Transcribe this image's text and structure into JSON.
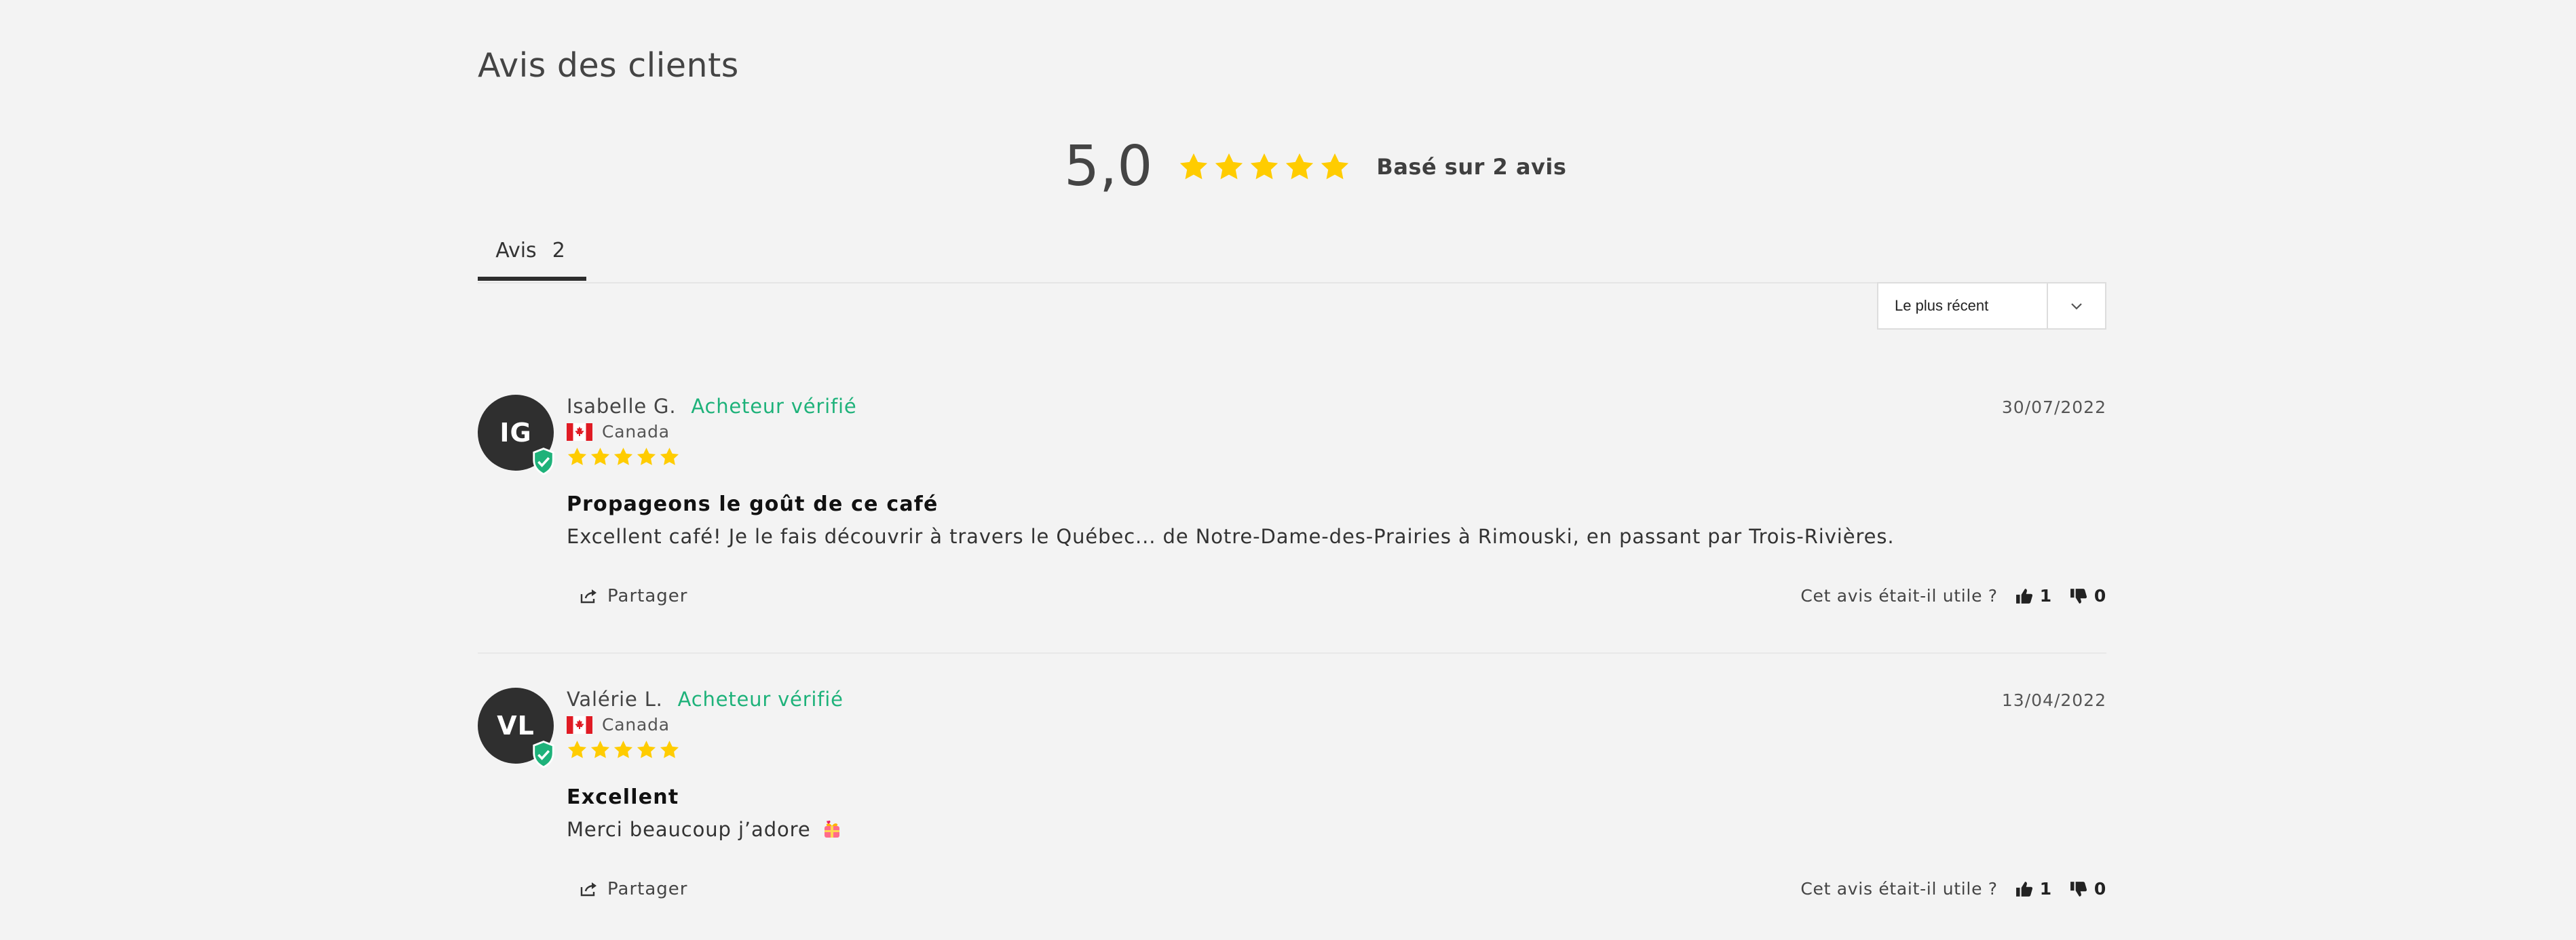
{
  "page": {
    "title": "Avis des clients"
  },
  "summary": {
    "average": "5,0",
    "based_on": "Basé sur 2 avis",
    "stars": 5
  },
  "tabs": [
    {
      "label": "Avis",
      "count": "2"
    }
  ],
  "sort": {
    "selected": "Le plus récent"
  },
  "reviews": [
    {
      "initials": "IG",
      "name": "Isabelle G.",
      "verified_label": "Acheteur vérifié",
      "country": "Canada",
      "date": "30/07/2022",
      "rating": 5,
      "title": "Propageons le goût de ce café",
      "text": "Excellent café! Je le fais découvrir à travers le Québec... de Notre-Dame-des-Prairies à Rimouski, en passant par Trois-Rivières.",
      "share_label": "Partager",
      "helpful_label": "Cet avis était-il utile ?",
      "up_votes": "1",
      "down_votes": "0"
    },
    {
      "initials": "VL",
      "name": "Valérie L.",
      "verified_label": "Acheteur vérifié",
      "country": "Canada",
      "date": "13/04/2022",
      "rating": 5,
      "title": "Excellent",
      "text": "Merci beaucoup j’adore",
      "text_emoji": "heart-gift-emoji",
      "share_label": "Partager",
      "helpful_label": "Cet avis était-il utile ?",
      "up_votes": "1",
      "down_votes": "0"
    }
  ],
  "colors": {
    "background": "#f3f3f3",
    "star": "#ffcc00",
    "verified": "#1eb27a",
    "avatar": "#2f2f2f",
    "tab_underline": "#2d2d2d"
  },
  "icons": {
    "star": "star-icon",
    "badge": "verified-shield-icon",
    "flag": "canada-flag-icon",
    "share": "share-icon",
    "thumbs_up": "thumbs-up-icon",
    "thumbs_down": "thumbs-down-icon",
    "chevron": "chevron-down-icon"
  }
}
